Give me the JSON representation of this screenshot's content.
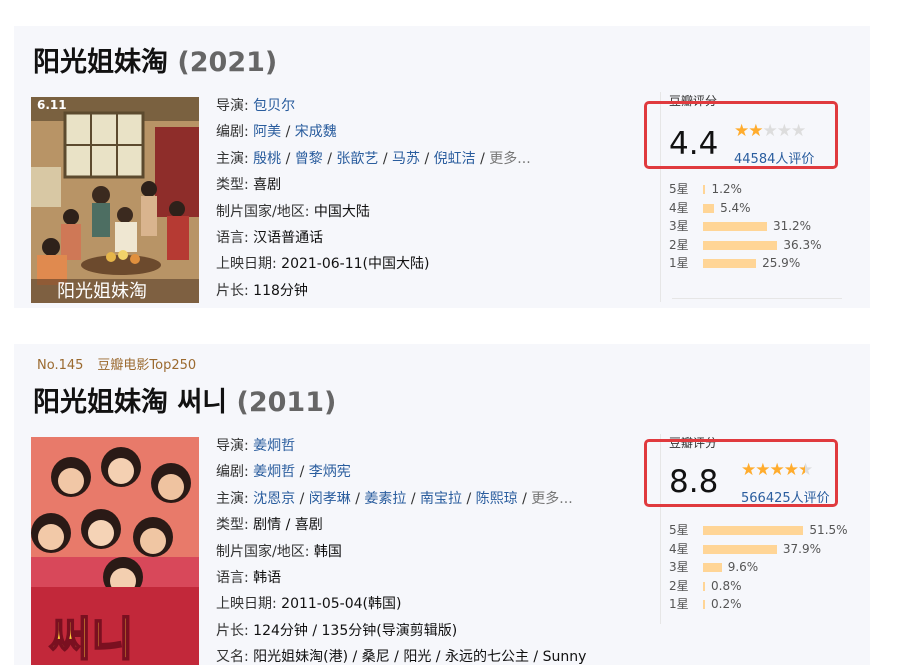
{
  "movie1": {
    "title": "阳光姐妹淘",
    "year": "(2021)",
    "poster_date": "6.11",
    "poster_title": "阳光姐妹淘",
    "info": {
      "director_label": "导演:",
      "director": "包贝尔",
      "writer_label": "编剧:",
      "writers": [
        "阿美",
        "宋成魏"
      ],
      "cast_label": "主演:",
      "cast": [
        "殷桃",
        "曾黎",
        "张歆艺",
        "马苏",
        "倪虹洁"
      ],
      "cast_more": "更多...",
      "genre_label": "类型:",
      "genre": "喜剧",
      "country_label": "制片国家/地区:",
      "country": "中国大陆",
      "language_label": "语言:",
      "language": "汉语普通话",
      "release_label": "上映日期:",
      "release": "2021-06-11(中国大陆)",
      "runtime_label": "片长:",
      "runtime": "118分钟"
    },
    "rating": {
      "label": "豆瓣评分",
      "score": "4.4",
      "stars_filled": 2,
      "count": "44584人评价",
      "breakdown": [
        {
          "label": "5星",
          "pct": "1.2%",
          "value": 1.2
        },
        {
          "label": "4星",
          "pct": "5.4%",
          "value": 5.4
        },
        {
          "label": "3星",
          "pct": "31.2%",
          "value": 31.2
        },
        {
          "label": "2星",
          "pct": "36.3%",
          "value": 36.3
        },
        {
          "label": "1星",
          "pct": "25.9%",
          "value": 25.9
        }
      ]
    }
  },
  "movie2": {
    "rank": "No.145",
    "top_list": "豆瓣电影Top250",
    "title": "阳光姐妹淘 써니",
    "year": "(2011)",
    "poster_title": "써니",
    "info": {
      "director_label": "导演:",
      "director": "姜炯哲",
      "writer_label": "编剧:",
      "writers": [
        "姜炯哲",
        "李炳宪"
      ],
      "cast_label": "主演:",
      "cast": [
        "沈恩京",
        "闵孝琳",
        "姜素拉",
        "南宝拉",
        "陈熙琼"
      ],
      "cast_more": "更多...",
      "genre_label": "类型:",
      "genre": "剧情 / 喜剧",
      "country_label": "制片国家/地区:",
      "country": "韩国",
      "language_label": "语言:",
      "language": "韩语",
      "release_label": "上映日期:",
      "release": "2011-05-04(韩国)",
      "runtime_label": "片长:",
      "runtime": "124分钟 / 135分钟(导演剪辑版)",
      "aka_label": "又名:",
      "aka": "阳光姐妹淘(港) / 桑尼 / 阳光 / 永远的七公主 / Sunny"
    },
    "rating": {
      "label": "豆瓣评分",
      "score": "8.8",
      "stars_filled": 4.5,
      "count": "566425人评价",
      "breakdown": [
        {
          "label": "5星",
          "pct": "51.5%",
          "value": 51.5
        },
        {
          "label": "4星",
          "pct": "37.9%",
          "value": 37.9
        },
        {
          "label": "3星",
          "pct": "9.6%",
          "value": 9.6
        },
        {
          "label": "2星",
          "pct": "0.8%",
          "value": 0.8
        },
        {
          "label": "1星",
          "pct": "0.2%",
          "value": 0.2
        }
      ]
    }
  }
}
